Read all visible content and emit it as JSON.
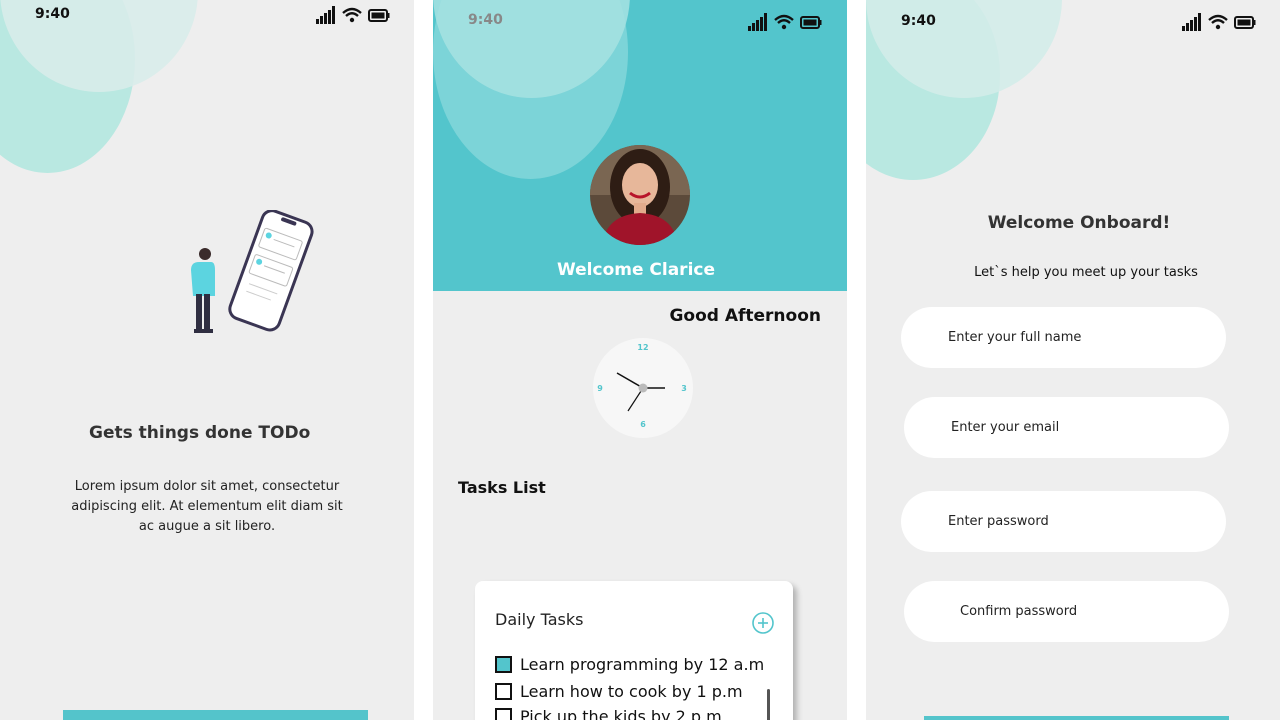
{
  "colors": {
    "accent": "#53c5cc",
    "accent_dark": "#54c4cb",
    "bubble_light": "#b9e8e1",
    "background": "#eeeeee"
  },
  "status_bar": {
    "time": "9:40",
    "icons": [
      "signal-icon",
      "wifi-icon",
      "battery-icon"
    ]
  },
  "intro_screen": {
    "title": "Gets things done TODo",
    "description": "Lorem ipsum dolor sit amet, consectetur adipiscing elit. At elementum elit diam sit ac augue a sit libero."
  },
  "home_screen": {
    "welcome": "Welcome Clarice",
    "greeting": "Good Afternoon",
    "clock_numbers": [
      "12",
      "3",
      "6",
      "9"
    ],
    "tasks_list_title": "Tasks List",
    "daily_tasks": {
      "title": "Daily Tasks",
      "items": [
        {
          "label": "Learn programming by 12 a.m",
          "checked": true
        },
        {
          "label": "Learn how to cook by 1 p.m",
          "checked": false
        },
        {
          "label": "Pick up the kids by 2 p.m",
          "checked": false
        }
      ]
    }
  },
  "onboard_screen": {
    "title": "Welcome Onboard!",
    "subtitle": "Let`s help you meet up your tasks",
    "fields": {
      "full_name_placeholder": "Enter your full name",
      "email_placeholder": "Enter your email",
      "password_placeholder": "Enter password",
      "confirm_password_placeholder": "Confirm password"
    }
  }
}
